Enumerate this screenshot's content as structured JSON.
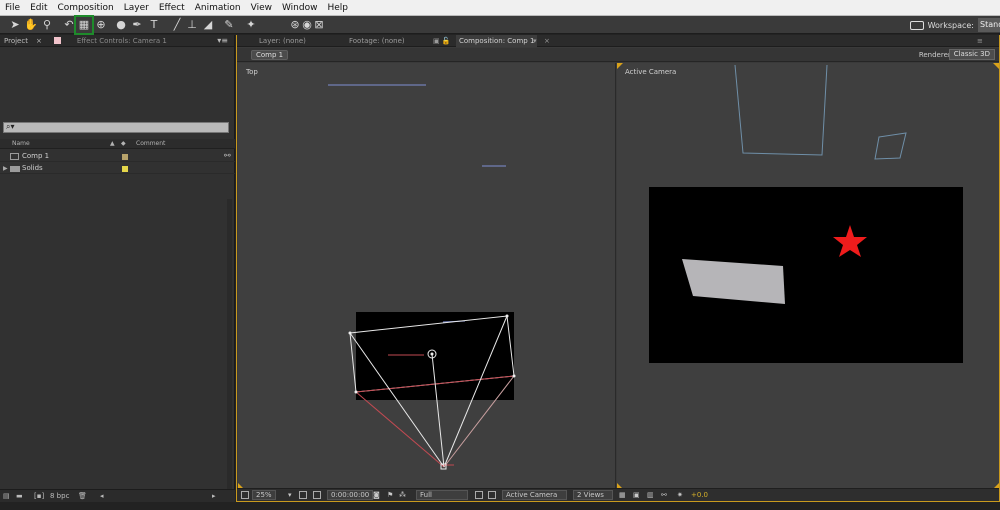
{
  "menu": [
    "File",
    "Edit",
    "Composition",
    "Layer",
    "Effect",
    "Animation",
    "View",
    "Window",
    "Help"
  ],
  "toolbar": {
    "workspace_label": "Workspace:",
    "workspace_value": "Standard"
  },
  "project_panel": {
    "tab_project": "Project",
    "tab_effect_controls": "Effect Controls: Camera 1",
    "col_name": "Name",
    "col_comment": "Comment",
    "items": [
      {
        "label": "Comp 1",
        "type": "composition",
        "color": "#b8a36b"
      },
      {
        "label": "Solids",
        "type": "folder",
        "color": "#e4d64a"
      }
    ],
    "bpc": "8 bpc"
  },
  "comp_panel": {
    "tab_layer": "Layer: (none)",
    "tab_footage": "Footage: (none)",
    "tab_composition": "Composition: Comp 1",
    "comp_button": "Comp 1",
    "renderer_label": "Renderer:",
    "renderer_value": "Classic 3D",
    "view_left_label": "Top",
    "view_right_label": "Active Camera",
    "zoom": "25%",
    "timecode": "0:00:00:00",
    "resolution": "Full",
    "camera_view": "Active Camera",
    "views_layout": "2 Views",
    "exposure": "+0.0",
    "accent_color": "#d9a21b"
  }
}
